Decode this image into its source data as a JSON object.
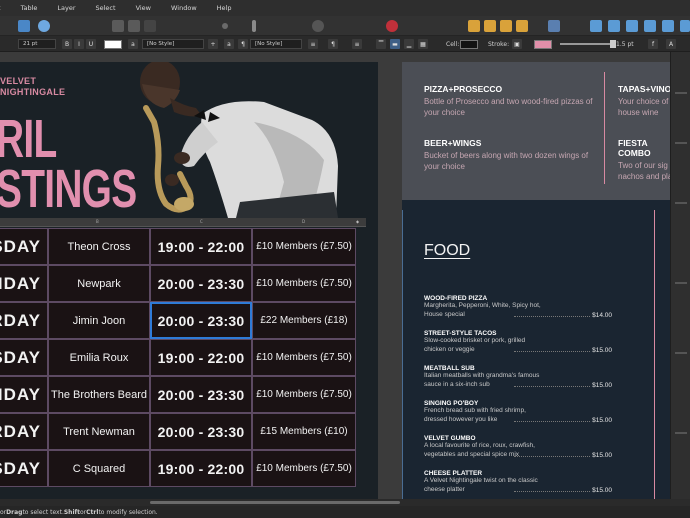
{
  "menu": [
    "t",
    "Table",
    "Layer",
    "Select",
    "View",
    "Window",
    "Help"
  ],
  "context": {
    "font_size": "21 pt",
    "bold": "B",
    "italic": "I",
    "underline": "U",
    "para_style": "[No Style]",
    "char_style": "[No Style]",
    "cell_label": "Cell:",
    "stroke_label": "Stroke:",
    "stroke_width": "1.5 pt",
    "cell_color": "#1a1a1a",
    "stroke_color": "#d88aa2"
  },
  "left_page": {
    "brand_line1": "VELVET",
    "brand_line2": "NIGHTINGALE",
    "title_line1": "RIL",
    "title_line2": "STINGS",
    "ruler_labels": [
      "B",
      "C",
      "D"
    ],
    "schedule": [
      {
        "day": "SDAY",
        "act": "Theon Cross",
        "time": "19:00 - 22:00",
        "price": "£10 Members (£7.50)"
      },
      {
        "day": "RIDAY",
        "act": "Newpark",
        "time": "20:00 - 23:30",
        "price": "£10 Members (£7.50)"
      },
      {
        "day": "RDAY",
        "act": "Jimin Joon",
        "time": "20:00 - 23:30",
        "price": "£22 Members (£18)"
      },
      {
        "day": "SDAY",
        "act": "Emilia Roux",
        "time": "19:00 - 22:00",
        "price": "£10 Members (£7.50)"
      },
      {
        "day": "RIDAY",
        "act": "The Brothers Beard",
        "time": "20:00 - 23:30",
        "price": "£10 Members (£7.50)"
      },
      {
        "day": "RDAY",
        "act": "Trent Newman",
        "time": "20:00 - 23:30",
        "price": "£15 Members (£10)"
      },
      {
        "day": "SDAY",
        "act": "C Squared",
        "time": "19:00 - 22:00",
        "price": "£10 Members (£7.50)"
      }
    ]
  },
  "right_page": {
    "promos": [
      {
        "title": "PIZZA+PROSECCO",
        "text": "Bottle of Prosecco and two wood-fired pizzas of your choice"
      },
      {
        "title": "BEER+WINGS",
        "text": "Bucket of beers along with two dozen wings of your choice"
      },
      {
        "title": "TAPAS+VINO",
        "text": "Your choice of house wine"
      },
      {
        "title": "FIESTA COMBO",
        "text": "Two of our sig nachos and pla"
      }
    ],
    "food_heading": "FOOD",
    "menu_items": [
      {
        "name": "WOOD-FIRED PIZZA",
        "desc": "Margherita, Pepperoni, White, Spicy hot, House special",
        "price": "$14.00"
      },
      {
        "name": "STREET-STYLE TACOS",
        "desc": "Slow-cooked brisket or pork, grilled chicken or veggie",
        "price": "$15.00"
      },
      {
        "name": "MEATBALL SUB",
        "desc": "Italian meatballs with grandma's famous sauce in a six-inch sub",
        "price": "$15.00"
      },
      {
        "name": "SINGING PO'BOY",
        "desc": "French bread sub with fried shrimp, dressed however you like",
        "price": "$15.00"
      },
      {
        "name": "VELVET GUMBO",
        "desc": "A local favourite of rice, roux, crawfish, vegetables and special spice mix",
        "price": "$15.00"
      },
      {
        "name": "CHEESE PLATTER",
        "desc": "A Velvet Nightingale twist on the classic cheese platter",
        "price": "$15.00"
      }
    ]
  },
  "status": {
    "prefix": "or ",
    "drag": "Drag",
    "mid": " to select text. ",
    "shift": "Shift",
    "or": " or ",
    "ctrl": "Ctrl",
    "suffix": " to modify selection."
  }
}
